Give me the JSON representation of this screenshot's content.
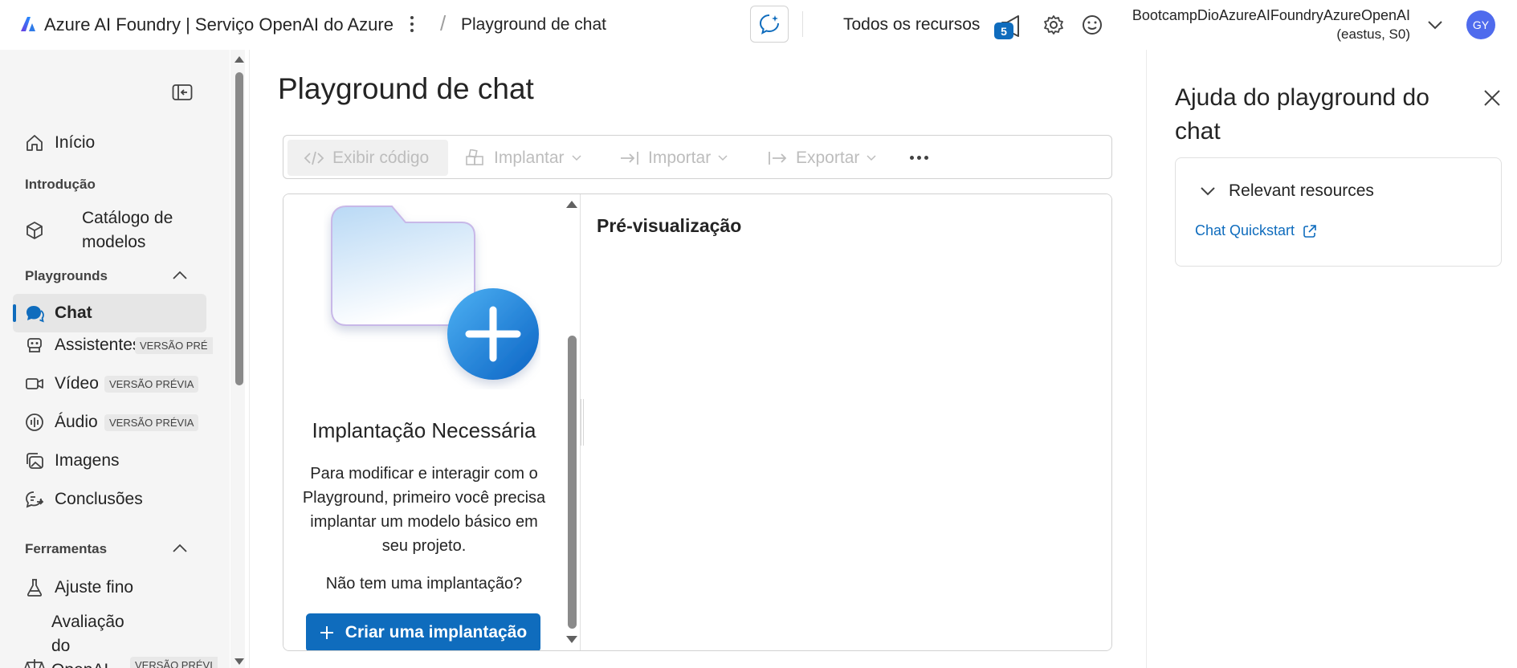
{
  "topbar": {
    "app_title": "Azure AI Foundry | Serviço OpenAI do Azure",
    "breadcrumb_separator": "/",
    "breadcrumb_current": "Playground de chat",
    "all_resources": "Todos os recursos",
    "notifications_count": "5",
    "account_name": "BootcampDioAzureAIFoundryAzureOpenAI",
    "account_detail": "(eastus, S0)",
    "avatar_initials": "GY"
  },
  "sidebar": {
    "sections": {
      "intro": "Introdução",
      "playgrounds": "Playgrounds",
      "tools": "Ferramentas"
    },
    "items": [
      {
        "label": "Início",
        "icon": "home-icon"
      },
      {
        "label": "Catálogo de modelos",
        "icon": "cube-icon"
      },
      {
        "label": "Chat",
        "icon": "chat-icon",
        "active": true
      },
      {
        "label": "Assistentes",
        "icon": "bot-icon",
        "tag": "VERSÃO PRÉ"
      },
      {
        "label": "Vídeo",
        "icon": "video-icon",
        "tag": "VERSÃO PRÉVIA"
      },
      {
        "label": "Áudio",
        "icon": "audio-icon",
        "tag": "VERSÃO PRÉVIA"
      },
      {
        "label": "Imagens",
        "icon": "images-icon"
      },
      {
        "label": "Conclusões",
        "icon": "completions-icon"
      },
      {
        "label": "Ajuste fino",
        "icon": "flask-icon"
      },
      {
        "label": "Avaliação do OpenAI",
        "icon": "scale-icon",
        "tag": "VERSÃO PRÉVI"
      }
    ]
  },
  "main": {
    "page_title": "Playground de chat",
    "toolbar": {
      "view_code": "Exibir código",
      "deploy": "Implantar",
      "import": "Importar",
      "export": "Exportar"
    },
    "setup": {
      "title": "Implantação Necessária",
      "body": "Para modificar e interagir com o Playground, primeiro você precisa implantar um modelo básico em seu projeto.",
      "question": "Não tem uma implantação?",
      "create_button": "Criar uma implantação"
    },
    "preview": {
      "title": "Pré-visualização"
    }
  },
  "help": {
    "title": "Ajuda do playground do chat",
    "card_title": "Relevant resources",
    "link": "Chat Quickstart"
  },
  "colors": {
    "accent": "#0f6cbd",
    "nav_background": "#f5f5f5",
    "avatar": "#4f6bed"
  }
}
